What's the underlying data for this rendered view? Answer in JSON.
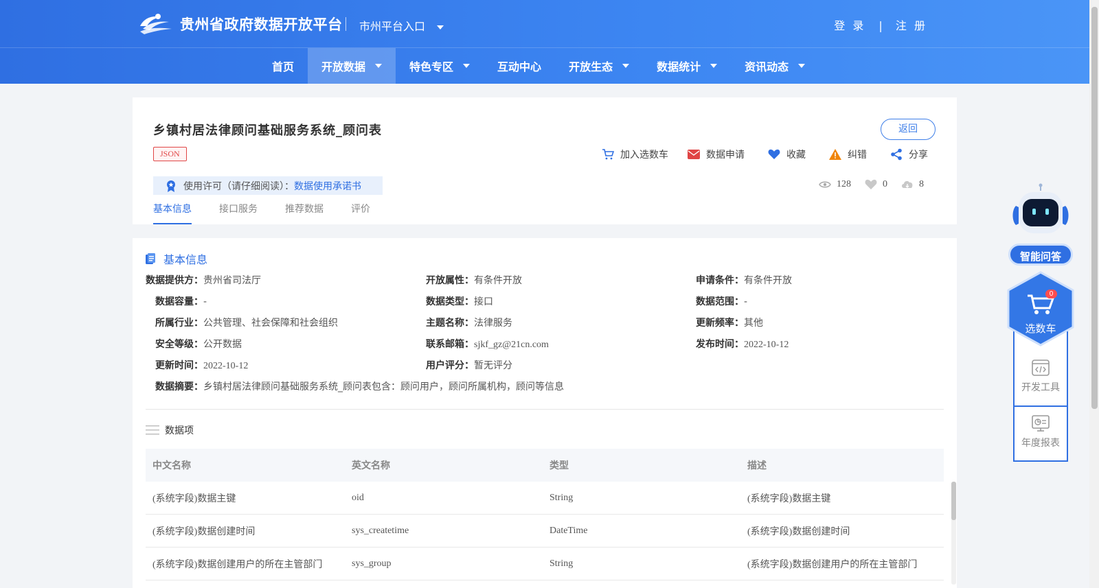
{
  "header": {
    "site_title": "贵州省政府数据开放平台",
    "city_entry": "市州平台入口",
    "login": "登 录",
    "separator": "|",
    "register": "注 册"
  },
  "nav": [
    {
      "label": "首页",
      "dropdown": false,
      "active": false
    },
    {
      "label": "开放数据",
      "dropdown": true,
      "active": true
    },
    {
      "label": "特色专区",
      "dropdown": true,
      "active": false
    },
    {
      "label": "互动中心",
      "dropdown": false,
      "active": false
    },
    {
      "label": "开放生态",
      "dropdown": true,
      "active": false
    },
    {
      "label": "数据统计",
      "dropdown": true,
      "active": false
    },
    {
      "label": "资讯动态",
      "dropdown": true,
      "active": false
    }
  ],
  "dataset": {
    "title": "乡镇村居法律顾问基础服务系统_顾问表",
    "format": "JSON",
    "back": "返回",
    "actions": {
      "cart": "加入选数车",
      "apply": "数据申请",
      "favorite": "收藏",
      "report": "纠错",
      "share": "分享"
    },
    "license_label": "使用许可（请仔细阅读）：",
    "license_link": "数据使用承诺书",
    "stats": {
      "views": "128",
      "likes": "0",
      "downloads": "8"
    },
    "tabs": [
      "基本信息",
      "接口服务",
      "推荐数据",
      "评价"
    ]
  },
  "basic_info": {
    "section_title": "基本信息",
    "provider": {
      "k": "数据提供方：",
      "v": "贵州省司法厅"
    },
    "open_attr": {
      "k": "开放属性：",
      "v": "有条件开放"
    },
    "apply_cond": {
      "k": "申请条件：",
      "v": "有条件开放"
    },
    "capacity": {
      "k": "数据容量：",
      "v": "-"
    },
    "data_type": {
      "k": "数据类型：",
      "v": "接口"
    },
    "scope": {
      "k": "数据范围：",
      "v": "-"
    },
    "industry": {
      "k": "所属行业：",
      "v": "公共管理、社会保障和社会组织"
    },
    "topic": {
      "k": "主题名称：",
      "v": "法律服务"
    },
    "frequency": {
      "k": "更新频率：",
      "v": "其他"
    },
    "security": {
      "k": "安全等级：",
      "v": "公开数据"
    },
    "email": {
      "k": "联系邮箱：",
      "v": "sjkf_gz@21cn.com"
    },
    "publish": {
      "k": "发布时间：",
      "v": "2022-10-12"
    },
    "update": {
      "k": "更新时间：",
      "v": "2022-10-12"
    },
    "rating": {
      "k": "用户评分：",
      "v": "暂无评分"
    },
    "summary": {
      "k": "数据摘要：",
      "v": "乡镇村居法律顾问基础服务系统_顾问表包含：顾问用户，顾问所属机构，顾问等信息"
    }
  },
  "data_items": {
    "title": "数据项",
    "headers": [
      "中文名称",
      "英文名称",
      "类型",
      "描述"
    ],
    "rows": [
      [
        "(系统字段)数据主键",
        "oid",
        "String",
        "(系统字段)数据主键"
      ],
      [
        "(系统字段)数据创建时间",
        "sys_createtime",
        "DateTime",
        "(系统字段)数据创建时间"
      ],
      [
        "(系统字段)数据创建用户的所在主管部门",
        "sys_group",
        "String",
        "(系统字段)数据创建用户的所在主管部门"
      ]
    ]
  },
  "side": {
    "ai_label": "智能问答",
    "cart_label": "选数车",
    "cart_count": "0",
    "dev_tools": "开发工具",
    "annual_report": "年度报表"
  },
  "colors": {
    "primary": "#2f6fe2",
    "danger": "#e04545"
  }
}
